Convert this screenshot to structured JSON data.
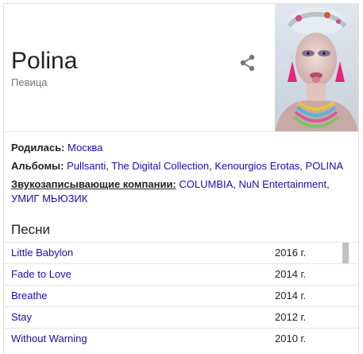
{
  "entity": {
    "name": "Polina",
    "type": "Певица"
  },
  "facts": [
    {
      "key": "Родилась:",
      "values": [
        "Москва"
      ]
    },
    {
      "key": "Альбомы:",
      "values": [
        "Pullsanti",
        "The Digital Collection",
        "Kenourgios Erotas",
        "POLINA"
      ]
    },
    {
      "key": "Звукозаписывающие компании:",
      "values": [
        "COLUMBIA",
        "NuN Entertainment",
        "УМИГ МЬЮЗИК"
      ]
    }
  ],
  "songs_section": {
    "title": "Песни",
    "rows": [
      {
        "name": "Little Babylon",
        "year": "2016 г."
      },
      {
        "name": "Fade to Love",
        "year": "2014 г."
      },
      {
        "name": "Breathe",
        "year": "2014 г."
      },
      {
        "name": "Stay",
        "year": "2012 г."
      },
      {
        "name": "Without Warning",
        "year": "2010 г."
      }
    ]
  },
  "icons": {
    "share": "share-icon"
  },
  "colors": {
    "link": "#1a0dab",
    "text": "#222222",
    "muted": "#777777",
    "divider": "#e6e6e6"
  }
}
